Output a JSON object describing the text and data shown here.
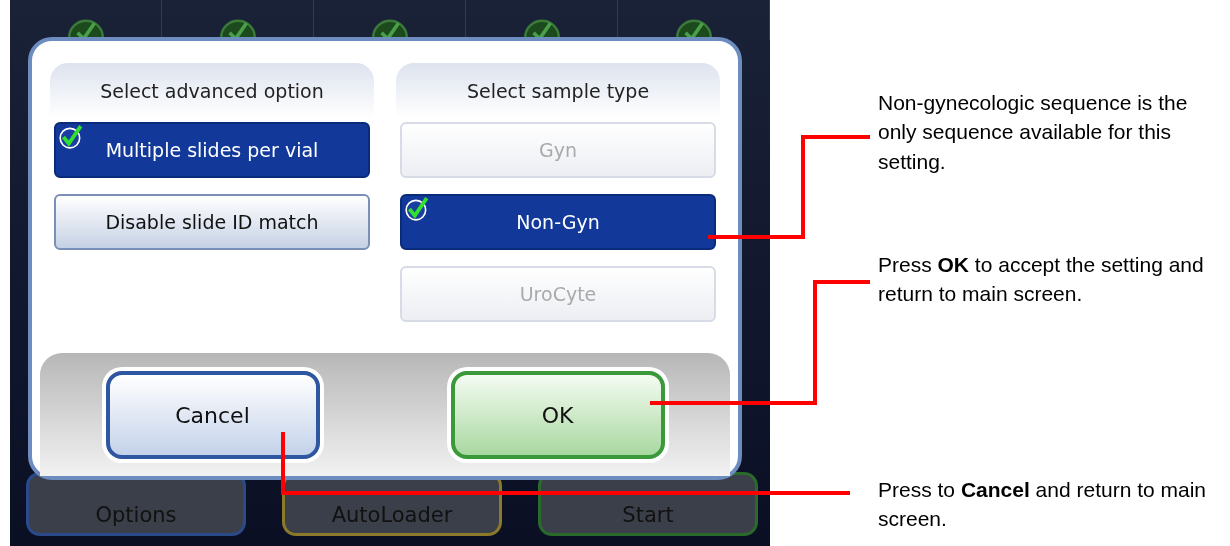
{
  "status_cells": [
    {
      "ok": true
    },
    {
      "ok": true
    },
    {
      "ok": true
    },
    {
      "ok": true
    },
    {
      "ok": true
    }
  ],
  "main_buttons": [
    {
      "label": "Options",
      "color": "#2a4a8a"
    },
    {
      "label": "AutoLoader",
      "color": "#8a7a2a"
    },
    {
      "label": "Start",
      "color": "#2a6a2a"
    }
  ],
  "dialog": {
    "left_panel": {
      "title": "Select advanced option",
      "options": [
        {
          "label": "Multiple slides per vial",
          "selected": true,
          "disabled": false
        },
        {
          "label": "Disable slide ID match",
          "selected": false,
          "disabled": false
        }
      ]
    },
    "right_panel": {
      "title": "Select sample type",
      "options": [
        {
          "label": "Gyn",
          "selected": false,
          "disabled": true
        },
        {
          "label": "Non-Gyn",
          "selected": true,
          "disabled": false
        },
        {
          "label": "UroCyte",
          "selected": false,
          "disabled": true
        }
      ]
    },
    "buttons": [
      {
        "label": "Cancel",
        "kind": "cancel"
      },
      {
        "label": "OK",
        "kind": "ok"
      }
    ]
  },
  "annotations": [
    {
      "text": "Non-gynecologic sequence is the only sequence available for this setting."
    },
    {
      "text": "Press **OK** to accept the setting and return to main screen."
    },
    {
      "text": "Press to **Cancel** and return to main screen."
    }
  ]
}
